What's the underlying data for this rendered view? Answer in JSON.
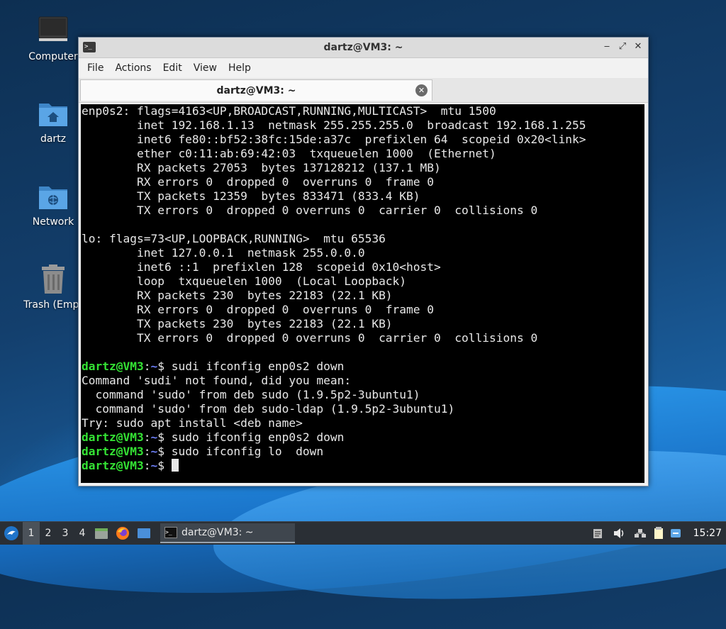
{
  "desktop": {
    "icons": [
      {
        "label": "Computer",
        "icon": "computer-icon"
      },
      {
        "label": "dartz",
        "icon": "home-folder-icon"
      },
      {
        "label": "Network",
        "icon": "network-folder-icon"
      },
      {
        "label": "Trash (Empt",
        "icon": "trash-icon"
      }
    ]
  },
  "window": {
    "title": "dartz@VM3: ~",
    "controls": {
      "minimize": "‒",
      "maximize": "⤢",
      "close": "✕"
    },
    "menu": [
      "File",
      "Actions",
      "Edit",
      "View",
      "Help"
    ],
    "tab": {
      "label": "dartz@VM3: ~",
      "close": "✕"
    }
  },
  "terminal": {
    "prompt_user": "dartz@VM3",
    "prompt_path": "~",
    "prompt_symbol": "$ ",
    "lines": [
      {
        "type": "out",
        "text": "enp0s2: flags=4163<UP,BROADCAST,RUNNING,MULTICAST>  mtu 1500"
      },
      {
        "type": "out",
        "text": "        inet 192.168.1.13  netmask 255.255.255.0  broadcast 192.168.1.255"
      },
      {
        "type": "out",
        "text": "        inet6 fe80::bf52:38fc:15de:a37c  prefixlen 64  scopeid 0x20<link>"
      },
      {
        "type": "out",
        "text": "        ether c0:11:ab:69:42:03  txqueuelen 1000  (Ethernet)"
      },
      {
        "type": "out",
        "text": "        RX packets 27053  bytes 137128212 (137.1 MB)"
      },
      {
        "type": "out",
        "text": "        RX errors 0  dropped 0  overruns 0  frame 0"
      },
      {
        "type": "out",
        "text": "        TX packets 12359  bytes 833471 (833.4 KB)"
      },
      {
        "type": "out",
        "text": "        TX errors 0  dropped 0 overruns 0  carrier 0  collisions 0"
      },
      {
        "type": "out",
        "text": ""
      },
      {
        "type": "out",
        "text": "lo: flags=73<UP,LOOPBACK,RUNNING>  mtu 65536"
      },
      {
        "type": "out",
        "text": "        inet 127.0.0.1  netmask 255.0.0.0"
      },
      {
        "type": "out",
        "text": "        inet6 ::1  prefixlen 128  scopeid 0x10<host>"
      },
      {
        "type": "out",
        "text": "        loop  txqueuelen 1000  (Local Loopback)"
      },
      {
        "type": "out",
        "text": "        RX packets 230  bytes 22183 (22.1 KB)"
      },
      {
        "type": "out",
        "text": "        RX errors 0  dropped 0  overruns 0  frame 0"
      },
      {
        "type": "out",
        "text": "        TX packets 230  bytes 22183 (22.1 KB)"
      },
      {
        "type": "out",
        "text": "        TX errors 0  dropped 0 overruns 0  carrier 0  collisions 0"
      },
      {
        "type": "out",
        "text": ""
      },
      {
        "type": "cmd",
        "text": "sudi ifconfig enp0s2 down"
      },
      {
        "type": "out",
        "text": "Command 'sudi' not found, did you mean:"
      },
      {
        "type": "out",
        "text": "  command 'sudo' from deb sudo (1.9.5p2-3ubuntu1)"
      },
      {
        "type": "out",
        "text": "  command 'sudo' from deb sudo-ldap (1.9.5p2-3ubuntu1)"
      },
      {
        "type": "out",
        "text": "Try: sudo apt install <deb name>"
      },
      {
        "type": "cmd",
        "text": "sudo ifconfig enp0s2 down"
      },
      {
        "type": "cmd",
        "text": "sudo ifconfig lo  down"
      },
      {
        "type": "cmd",
        "text": "",
        "cursor": true
      }
    ]
  },
  "taskbar": {
    "start_icon": "lubuntu-logo-icon",
    "workspaces": [
      "1",
      "2",
      "3",
      "4"
    ],
    "active_workspace": "1",
    "launchers": [
      "file-manager-icon",
      "firefox-icon",
      "show-desktop-icon"
    ],
    "task_label": "dartz@VM3: ~",
    "tray": [
      "clipboard-icon",
      "volume-icon",
      "network-icon",
      "notes-icon",
      "update-icon"
    ],
    "clock": "15:27"
  },
  "colors": {
    "prompt_user": "#34e234",
    "prompt_path": "#6c7ef5",
    "terminal_bg": "#000000",
    "terminal_fg": "#e8e8e8"
  }
}
